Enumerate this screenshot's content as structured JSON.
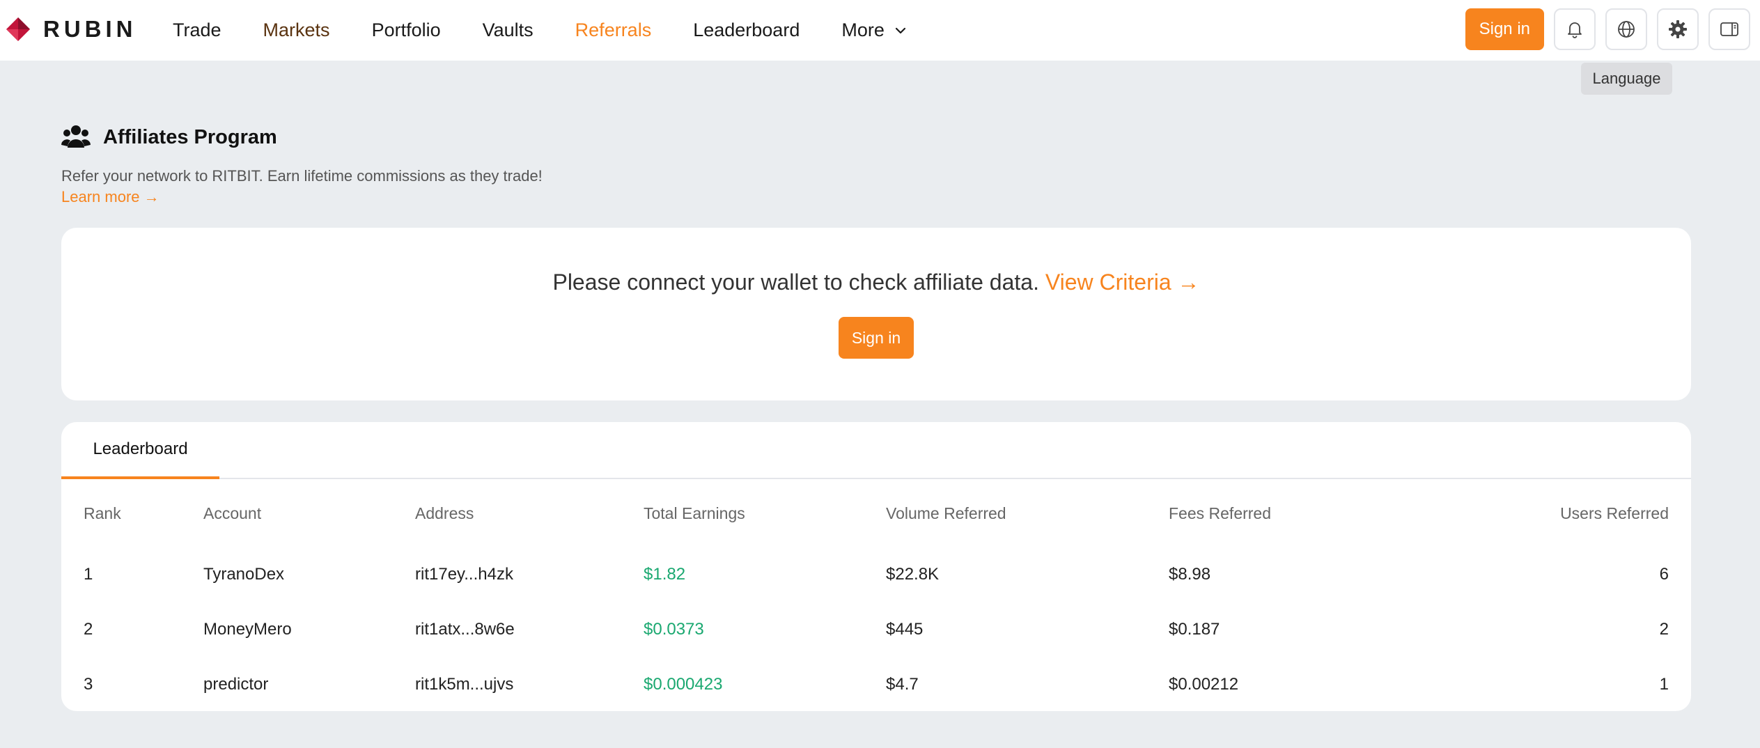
{
  "brand": {
    "name": "RUBIN"
  },
  "nav": {
    "items": [
      {
        "label": "Trade"
      },
      {
        "label": "Markets"
      },
      {
        "label": "Portfolio"
      },
      {
        "label": "Vaults"
      },
      {
        "label": "Referrals"
      },
      {
        "label": "Leaderboard"
      },
      {
        "label": "More"
      }
    ],
    "active": "Referrals"
  },
  "header_actions": {
    "signin_label": "Sign in",
    "icons": [
      "bell-icon",
      "globe-icon",
      "gear-icon",
      "panel-icon"
    ],
    "tooltip": "Language"
  },
  "affiliates": {
    "title": "Affiliates Program",
    "description": "Refer your network to RITBIT. Earn lifetime commissions as they trade!",
    "learn_more": "Learn more →"
  },
  "connect": {
    "message": "Please connect your wallet to check affiliate data.",
    "criteria_link": "View Criteria →",
    "signin_label": "Sign in"
  },
  "leaderboard": {
    "tab_label": "Leaderboard",
    "columns": [
      "Rank",
      "Account",
      "Address",
      "Total Earnings",
      "Volume Referred",
      "Fees Referred",
      "Users Referred"
    ],
    "rows": [
      {
        "rank": "1",
        "account": "TyranoDex",
        "address": "rit17ey...h4zk",
        "earnings": "$1.82",
        "volume": "$22.8K",
        "fees": "$8.98",
        "users": "6"
      },
      {
        "rank": "2",
        "account": "MoneyMero",
        "address": "rit1atx...8w6e",
        "earnings": "$0.0373",
        "volume": "$445",
        "fees": "$0.187",
        "users": "2"
      },
      {
        "rank": "3",
        "account": "predictor",
        "address": "rit1k5m...ujvs",
        "earnings": "$0.000423",
        "volume": "$4.7",
        "fees": "$0.00212",
        "users": "1"
      }
    ]
  },
  "colors": {
    "accent": "#f7841e",
    "earnings_green": "#1aa870",
    "logo_red": "#c2143a",
    "background": "#eaedf0"
  }
}
